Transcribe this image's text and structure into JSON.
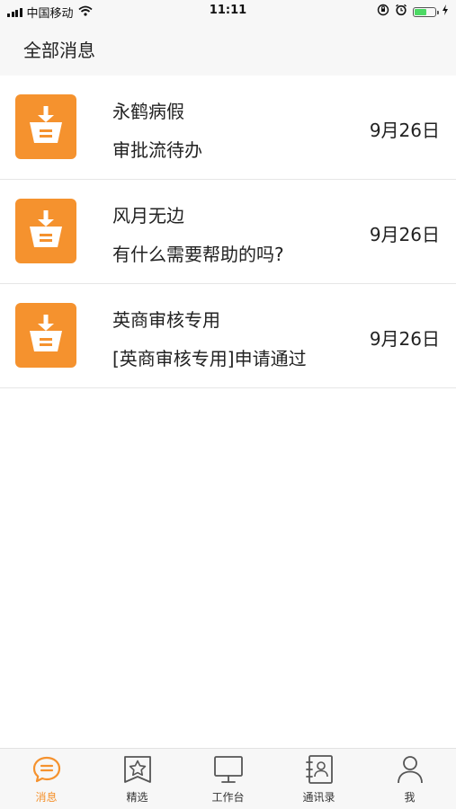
{
  "status_bar": {
    "carrier": "中国移动",
    "time": "11:11",
    "battery_level": 0.6
  },
  "header": {
    "title": "全部消息"
  },
  "messages": [
    {
      "sender": "永鹤病假",
      "preview": "审批流待办",
      "date": "9月26日",
      "icon": "basket-download-icon"
    },
    {
      "sender": "风月无边",
      "preview": "有什么需要帮助的吗?",
      "date": "9月26日",
      "icon": "basket-download-icon"
    },
    {
      "sender": "英商审核专用",
      "preview": "[英商审核专用]申请通过",
      "date": "9月26日",
      "icon": "basket-download-icon"
    }
  ],
  "tabs": [
    {
      "label": "消息",
      "icon": "chat-bubble-icon",
      "active": true
    },
    {
      "label": "精选",
      "icon": "star-bookmark-icon",
      "active": false
    },
    {
      "label": "工作台",
      "icon": "monitor-icon",
      "active": false
    },
    {
      "label": "通讯录",
      "icon": "contact-book-icon",
      "active": false
    },
    {
      "label": "我",
      "icon": "person-icon",
      "active": false
    }
  ],
  "colors": {
    "accent": "#f5922e",
    "battery": "#4cd964",
    "header_bg": "#f7f7f7"
  }
}
